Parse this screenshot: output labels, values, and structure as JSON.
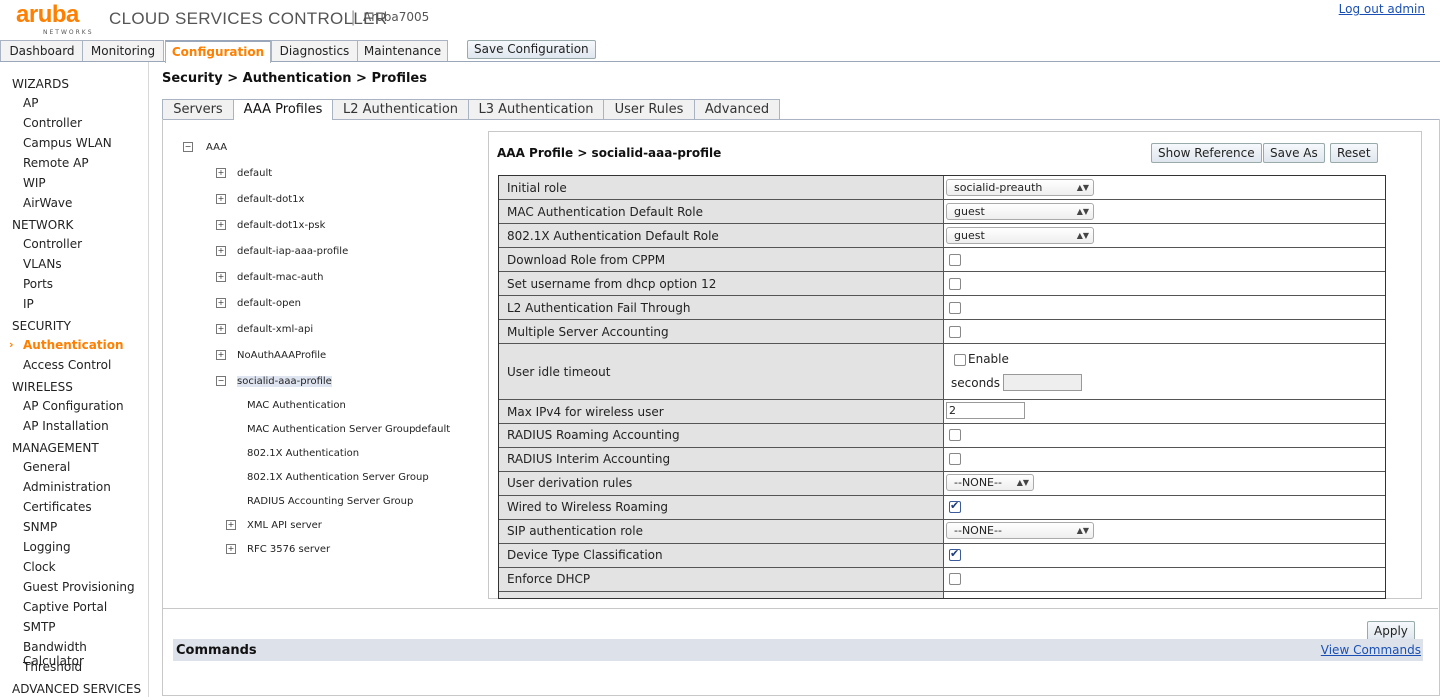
{
  "header": {
    "logo_text": "aruba",
    "logo_sub": "NETWORKS",
    "product_title": "CLOUD SERVICES CONTROLLER",
    "device_name": "Aruba7005",
    "logout_label": "Log out admin"
  },
  "topnav": {
    "tabs": [
      "Dashboard",
      "Monitoring",
      "Configuration",
      "Diagnostics",
      "Maintenance"
    ],
    "active": "Configuration",
    "save_label": "Save Configuration"
  },
  "sidebar": {
    "sections": [
      {
        "title": "WIZARDS",
        "items": [
          "AP",
          "Controller",
          "Campus WLAN",
          "Remote AP",
          "WIP",
          "AirWave"
        ]
      },
      {
        "title": "NETWORK",
        "items": [
          "Controller",
          "VLANs",
          "Ports",
          "IP"
        ]
      },
      {
        "title": "SECURITY",
        "items": [
          "Authentication",
          "Access Control"
        ]
      },
      {
        "title": "WIRELESS",
        "items": [
          "AP Configuration",
          "AP Installation"
        ]
      },
      {
        "title": "MANAGEMENT",
        "items": [
          "General",
          "Administration",
          "Certificates",
          "SNMP",
          "Logging",
          "Clock",
          "Guest Provisioning",
          "Captive Portal",
          "SMTP",
          "Bandwidth Calculator",
          "Threshold"
        ]
      },
      {
        "title": "ADVANCED SERVICES",
        "items": []
      }
    ],
    "active_item": "Authentication"
  },
  "breadcrumb": "Security > Authentication > Profiles",
  "subtabs": [
    "Servers",
    "AAA Profiles",
    "L2 Authentication",
    "L3 Authentication",
    "User Rules",
    "Advanced"
  ],
  "tree": {
    "root": "AAA",
    "profiles": [
      "default",
      "default-dot1x",
      "default-dot1x-psk",
      "default-iap-aaa-profile",
      "default-mac-auth",
      "default-open",
      "default-xml-api",
      "NoAuthAAAProfile",
      "socialid-aaa-profile"
    ],
    "selected": "socialid-aaa-profile",
    "children": [
      {
        "label": "MAC Authentication",
        "value": ""
      },
      {
        "label": "MAC Authentication Server Group",
        "value": "default"
      },
      {
        "label": "802.1X Authentication",
        "value": ""
      },
      {
        "label": "802.1X Authentication Server Group",
        "value": ""
      },
      {
        "label": "RADIUS Accounting Server Group",
        "value": ""
      }
    ],
    "expandable_children": [
      "XML API server",
      "RFC 3576 server"
    ]
  },
  "profile": {
    "title": "AAA Profile > socialid-aaa-profile",
    "buttons": [
      "Show Reference",
      "Save As",
      "Reset"
    ],
    "rows": [
      {
        "label": "Initial role",
        "type": "select",
        "value": "socialid-preauth"
      },
      {
        "label": "MAC Authentication Default Role",
        "type": "select",
        "value": "guest"
      },
      {
        "label": "802.1X Authentication Default Role",
        "type": "select",
        "value": "guest"
      },
      {
        "label": "Download Role from CPPM",
        "type": "checkbox",
        "checked": false
      },
      {
        "label": "Set username from dhcp option 12",
        "type": "checkbox",
        "checked": false
      },
      {
        "label": "L2 Authentication Fail Through",
        "type": "checkbox",
        "checked": false
      },
      {
        "label": "Multiple Server Accounting",
        "type": "checkbox",
        "checked": false
      },
      {
        "label": "User idle timeout",
        "type": "timeout",
        "enable_label": "Enable",
        "seconds_label": "seconds",
        "checked": false,
        "value": ""
      },
      {
        "label": "Max IPv4 for wireless user",
        "type": "text",
        "value": "2"
      },
      {
        "label": "RADIUS Roaming Accounting",
        "type": "checkbox",
        "checked": false
      },
      {
        "label": "RADIUS Interim Accounting",
        "type": "checkbox",
        "checked": false
      },
      {
        "label": "User derivation rules",
        "type": "select",
        "value": "--NONE--"
      },
      {
        "label": "Wired to Wireless Roaming",
        "type": "checkbox",
        "checked": true
      },
      {
        "label": "SIP authentication role",
        "type": "select",
        "value": "--NONE--"
      },
      {
        "label": "Device Type Classification",
        "type": "checkbox",
        "checked": true
      },
      {
        "label": "Enforce DHCP",
        "type": "checkbox",
        "checked": false
      }
    ]
  },
  "footer": {
    "apply_label": "Apply",
    "commands_title": "Commands",
    "view_commands_label": "View Commands"
  }
}
